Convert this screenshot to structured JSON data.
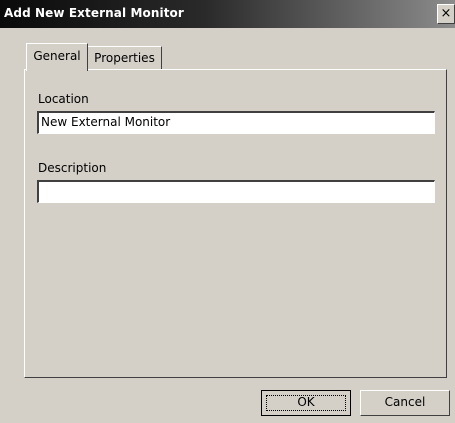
{
  "window": {
    "title": "Add New External Monitor",
    "close_glyph": "×",
    "close_icon": "close-icon"
  },
  "tabs": [
    {
      "label": "General",
      "selected": true
    },
    {
      "label": "Properties",
      "selected": false
    }
  ],
  "form": {
    "location_label": "Location",
    "location_value": "New External Monitor",
    "description_label": "Description",
    "description_value": ""
  },
  "buttons": {
    "ok_label": "OK",
    "cancel_label": "Cancel"
  },
  "colors": {
    "face": "#d4d0c8",
    "title_start": "#0a0a0a",
    "title_end": "#8c8c8c",
    "field_bg": "#ffffff"
  }
}
